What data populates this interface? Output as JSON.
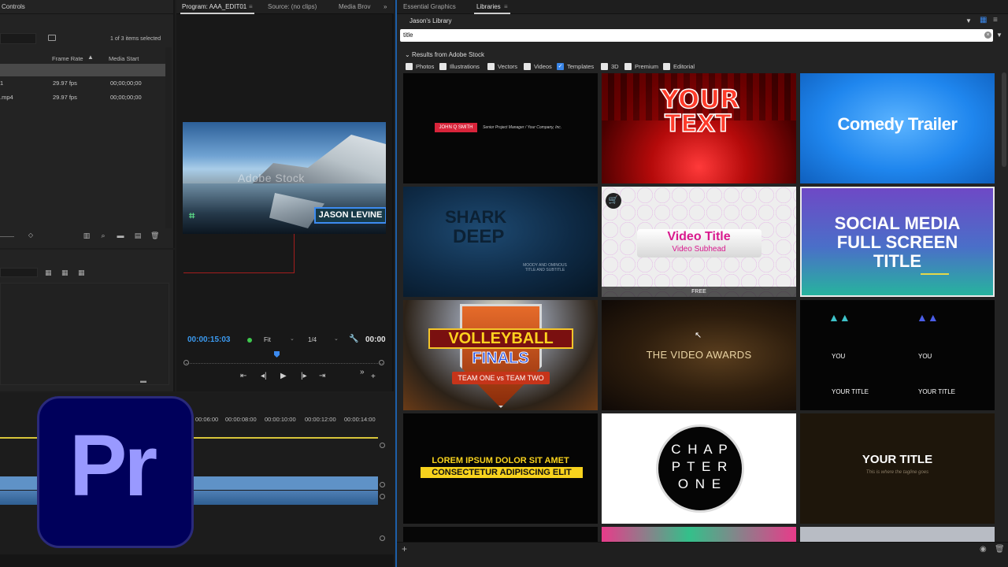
{
  "project_panel": {
    "tab_title": "Controls",
    "items_count": "1 of 3 items selected",
    "columns": {
      "frame_rate": "Frame Rate",
      "media_start": "Media Start"
    },
    "rows": [
      {
        "name": "1",
        "frame_rate": "29.97 fps",
        "media_start": "00;00;00;00"
      },
      {
        "name": ".mp4",
        "frame_rate": "29.97 fps",
        "media_start": "00;00;00;00"
      }
    ]
  },
  "program_monitor": {
    "tabs": [
      "Program: AAA_EDIT01",
      "Source: (no clips)",
      "Media Brov"
    ],
    "video_watermark": "Adobe Stock",
    "lower_third_text": "JASON LEVINE",
    "timecode": "00:00:15:03",
    "timecode_right": "00:00",
    "fit_label": "Fit",
    "resolution_label": "1/4"
  },
  "timeline": {
    "ruler_ticks": [
      "00:06:00",
      "00:00:08:00",
      "00:00:10:00",
      "00:00:12:00",
      "00:00:14:00"
    ]
  },
  "app_logo": {
    "text": "Pr",
    "bg_color": "#00005b",
    "fg_color": "#9999ff"
  },
  "libraries_panel": {
    "tabs": [
      "Essential Graphics",
      "Libraries"
    ],
    "library_name": "Jason's Library",
    "search_value": "title",
    "results_header": "Results from Adobe Stock",
    "filters": [
      {
        "label": "Photos",
        "checked": false
      },
      {
        "label": "Illustrations",
        "checked": false
      },
      {
        "label": "Vectors",
        "checked": false
      },
      {
        "label": "Videos",
        "checked": false
      },
      {
        "label": "Templates",
        "checked": true
      },
      {
        "label": "3D",
        "checked": false
      },
      {
        "label": "Premium",
        "checked": false
      },
      {
        "label": "Editorial",
        "checked": false
      }
    ],
    "thumbnails": {
      "t1": {
        "name_tag": "JOHN Q SMITH",
        "subtitle": "Senior Project Manager / Your Company, Inc."
      },
      "t2": {
        "line1": "YOUR",
        "line2": "TEXT"
      },
      "t3": {
        "title": "Comedy Trailer"
      },
      "t4": {
        "line1": "SHARK",
        "line2": "DEEP",
        "caption": "MOODY AND OMINOUS TITLE AND SUBTITLE"
      },
      "t5": {
        "title": "Video Title",
        "subtitle": "Video Subhead",
        "badge": "FREE"
      },
      "t6": {
        "line1": "SOCIAL MEDIA",
        "line2": "FULL SCREEN",
        "line3": "TITLE"
      },
      "t7": {
        "line1": "VOLLEYBALL",
        "line2": "FINALS",
        "ribbon": "TEAM ONE vs TEAM TWO"
      },
      "t8": {
        "title": "THE VIDEO AWARDS"
      },
      "t9": {
        "labels": [
          "YOU",
          "YOU",
          "YOUR TITLE",
          "YOUR TITLE"
        ]
      },
      "t10": {
        "line1": "LOREM IPSUM DOLOR SIT AMET",
        "line2": "CONSECTETUR ADIPISCING ELIT"
      },
      "t11": {
        "line1": "C H A P",
        "line2": "P T E R",
        "line3": "O N E"
      },
      "t12": {
        "title": "YOUR TITLE",
        "subtitle": "This is where the tagline goes"
      }
    }
  }
}
